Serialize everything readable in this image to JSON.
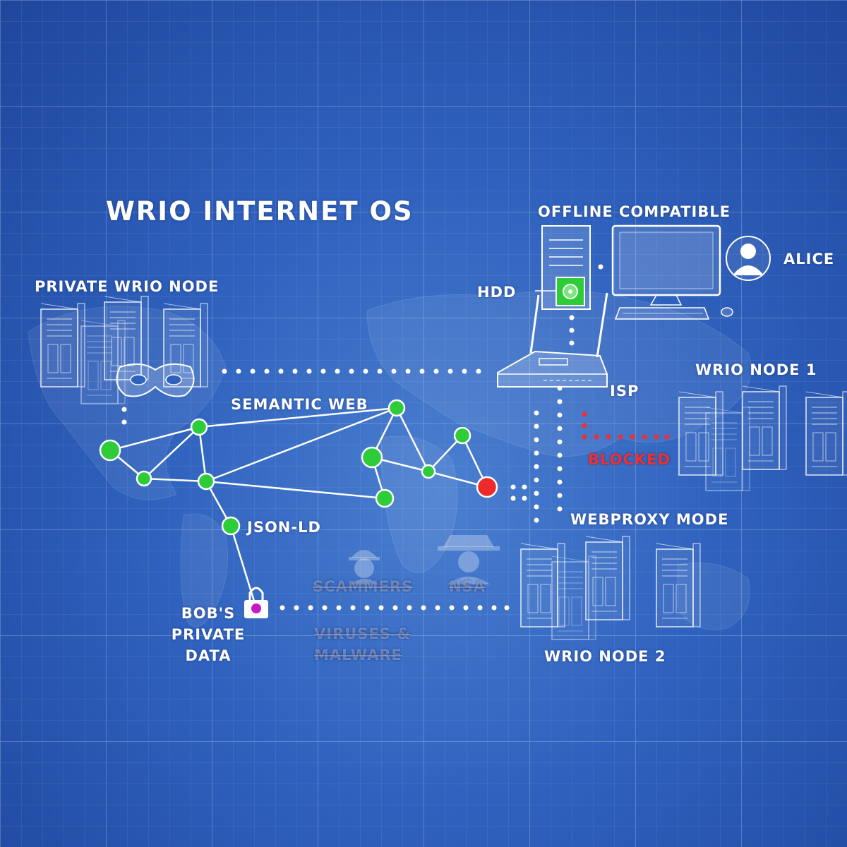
{
  "colors": {
    "node_green": "#2fcc3a",
    "node_red": "#ee2b2b",
    "blocked_red": "#ee3030",
    "lock_purple": "#c818c8",
    "line_white": "#ffffff"
  },
  "title": "WRIO INTERNET OS",
  "labels": {
    "offline_compatible": "OFFLINE COMPATIBLE",
    "alice": "ALICE",
    "hdd": "HDD",
    "private_node": "PRIVATE WRIO NODE",
    "node1": "WRIO NODE 1",
    "isp": "ISP",
    "semantic_web": "SEMANTIC WEB",
    "blocked": "BLOCKED",
    "webproxy": "WEBPROXY MODE",
    "json_ld": "JSON-LD",
    "scammers": "SCAMMERS",
    "nsa": "NSA",
    "bob_line1": "BOB'S",
    "bob_line2": "PRIVATE",
    "bob_line3": "DATA",
    "viruses_line1": "VIRUSES &",
    "viruses_line2": "MALWARE",
    "node2": "WRIO NODE 2"
  },
  "icons": [
    "server-cluster-icon",
    "mask-icon",
    "desktop-tower-icon",
    "monitor-icon",
    "keyboard-icon",
    "mouse-icon",
    "router-icon",
    "user-avatar-icon",
    "padlock-icon",
    "scammer-icon",
    "spy-icon",
    "world-map"
  ]
}
